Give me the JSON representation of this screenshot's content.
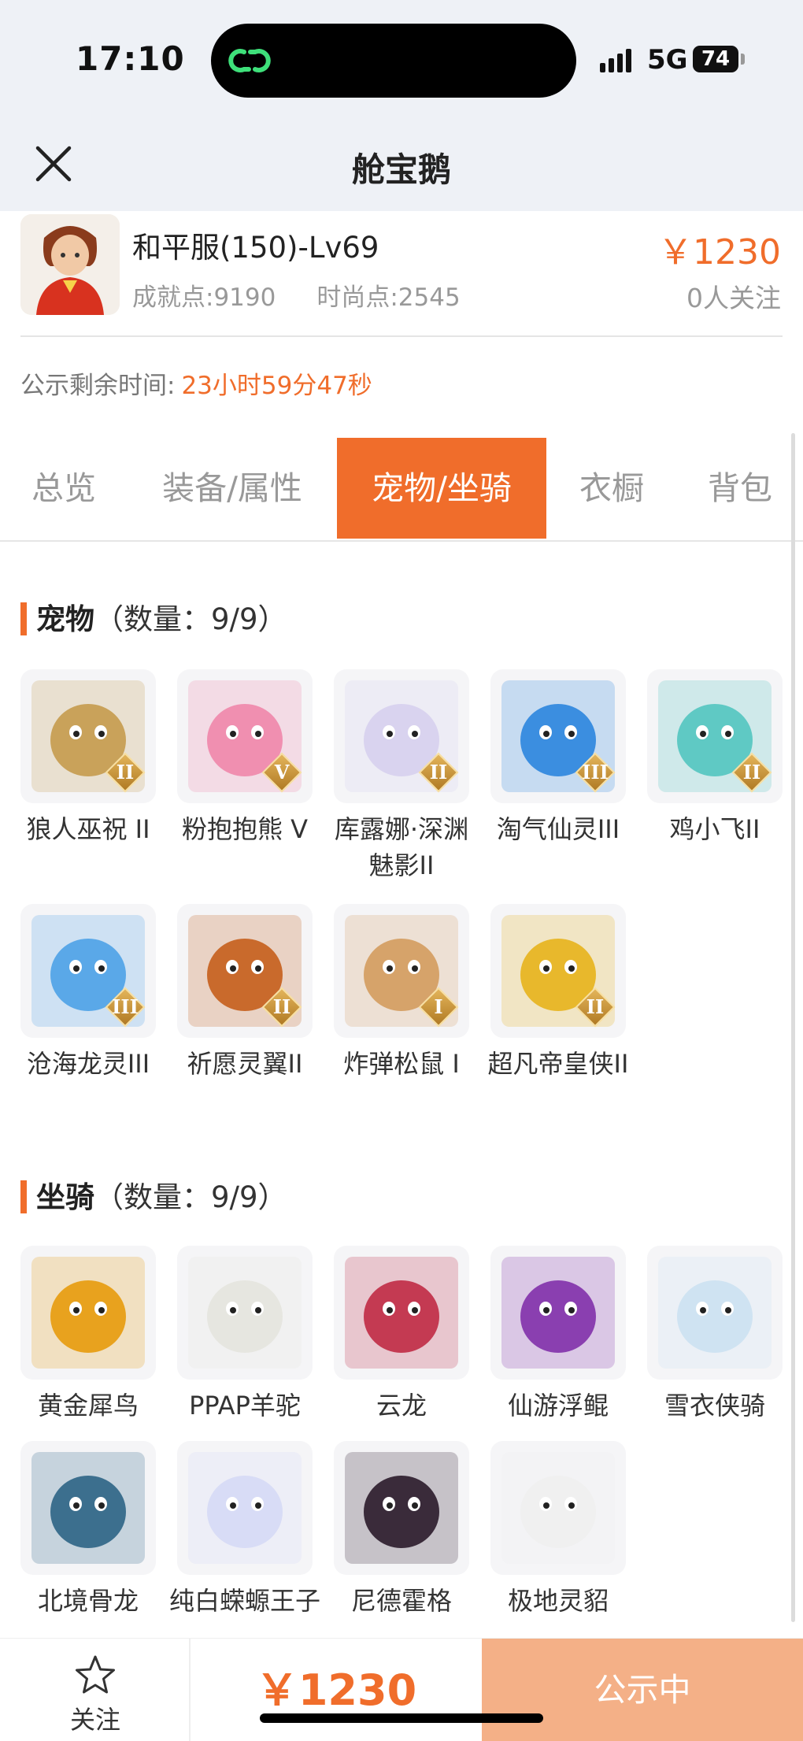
{
  "status_bar": {
    "time": "17:10",
    "network": "5G",
    "battery": "74"
  },
  "nav": {
    "title": "舱宝鹅"
  },
  "listing": {
    "server": "和平服(150)-Lv69",
    "achievement": "成就点:9190",
    "fashion": "时尚点:2545",
    "price": "￥1230",
    "followers": "0人关注",
    "timer_label": "公示剩余时间:",
    "timer_value": "23小时59分47秒"
  },
  "tabs": [
    {
      "label": "总览"
    },
    {
      "label": "装备/属性"
    },
    {
      "label": "宠物/坐骑"
    },
    {
      "label": "衣橱"
    },
    {
      "label": "背包"
    }
  ],
  "pets": {
    "title": "宠物",
    "count": "（数量：9/9）",
    "items": [
      {
        "name": "狼人巫祝 II",
        "grade": "II",
        "color": "#c9a25a"
      },
      {
        "name": "粉抱抱熊 V",
        "grade": "V",
        "color": "#f08fb0"
      },
      {
        "name": "库露娜·深渊魅影II",
        "grade": "II",
        "color": "#d9d3ef"
      },
      {
        "name": "淘气仙灵III",
        "grade": "III",
        "color": "#3b8ee0"
      },
      {
        "name": "鸡小飞II",
        "grade": "II",
        "color": "#5fc9c4"
      },
      {
        "name": "沧海龙灵III",
        "grade": "III",
        "color": "#5aa8e8"
      },
      {
        "name": "祈愿灵翼II",
        "grade": "II",
        "color": "#c96a2c"
      },
      {
        "name": "炸弹松鼠 I",
        "grade": "I",
        "color": "#d6a36a"
      },
      {
        "name": "超凡帝皇侠II",
        "grade": "II",
        "color": "#e8b82c"
      }
    ]
  },
  "mounts": {
    "title": "坐骑",
    "count": "（数量：9/9）",
    "items": [
      {
        "name": "黄金犀鸟",
        "color": "#e8a21e"
      },
      {
        "name": "PPAP羊驼",
        "color": "#e6e6e0"
      },
      {
        "name": "云龙",
        "color": "#c43a52"
      },
      {
        "name": "仙游浮鲲",
        "color": "#8a3fb0"
      },
      {
        "name": "雪衣侠骑",
        "color": "#cfe3f2"
      },
      {
        "name": "北境骨龙",
        "color": "#3c6f8e"
      },
      {
        "name": "纯白蝾螈王子",
        "color": "#d8dcf6"
      },
      {
        "name": "尼德霍格",
        "color": "#3a2b3a"
      },
      {
        "name": "极地灵貂",
        "color": "#f0f0f0"
      }
    ]
  },
  "bottom_bar": {
    "follow_label": "关注",
    "price": "￥1230",
    "status": "公示中"
  }
}
